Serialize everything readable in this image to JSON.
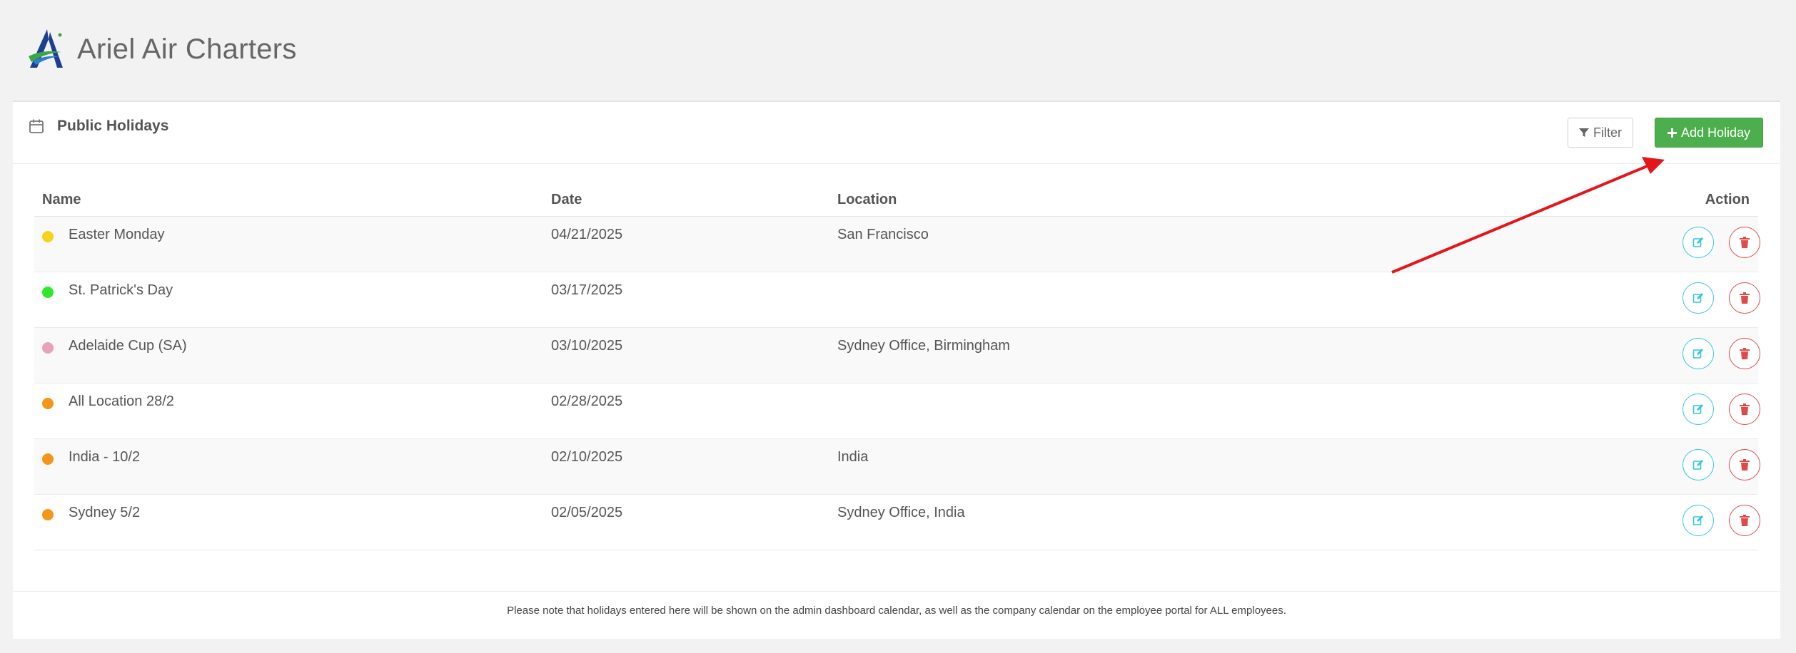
{
  "app": {
    "title": "Ariel Air Charters"
  },
  "panel": {
    "title": "Public Holidays",
    "filter_label": "Filter",
    "add_label": "Add Holiday"
  },
  "table": {
    "columns": {
      "name": "Name",
      "date": "Date",
      "location": "Location",
      "action": "Action"
    },
    "rows": [
      {
        "name": "Easter Monday",
        "date": "04/21/2025",
        "location": "San Francisco",
        "color": "#f5d31a"
      },
      {
        "name": "St. Patrick's Day",
        "date": "03/17/2025",
        "location": "",
        "color": "#2ee82e"
      },
      {
        "name": "Adelaide Cup (SA)",
        "date": "03/10/2025",
        "location": "Sydney Office, Birmingham",
        "color": "#e8a3b8"
      },
      {
        "name": "All Location 28/2",
        "date": "02/28/2025",
        "location": "",
        "color": "#f5961a"
      },
      {
        "name": "India - 10/2",
        "date": "02/10/2025",
        "location": "India",
        "color": "#f5961a"
      },
      {
        "name": "Sydney 5/2",
        "date": "02/05/2025",
        "location": "Sydney Office, India",
        "color": "#f5961a"
      }
    ]
  },
  "footer": {
    "note": "Please note that holidays entered here will be shown on the admin dashboard calendar, as well as the company calendar on the employee portal for ALL employees."
  },
  "colors": {
    "accent_green": "#4cae4c",
    "edit_cyan": "#33c6e0",
    "delete_red": "#e24a4a",
    "annotation_arrow": "#e3161b"
  }
}
